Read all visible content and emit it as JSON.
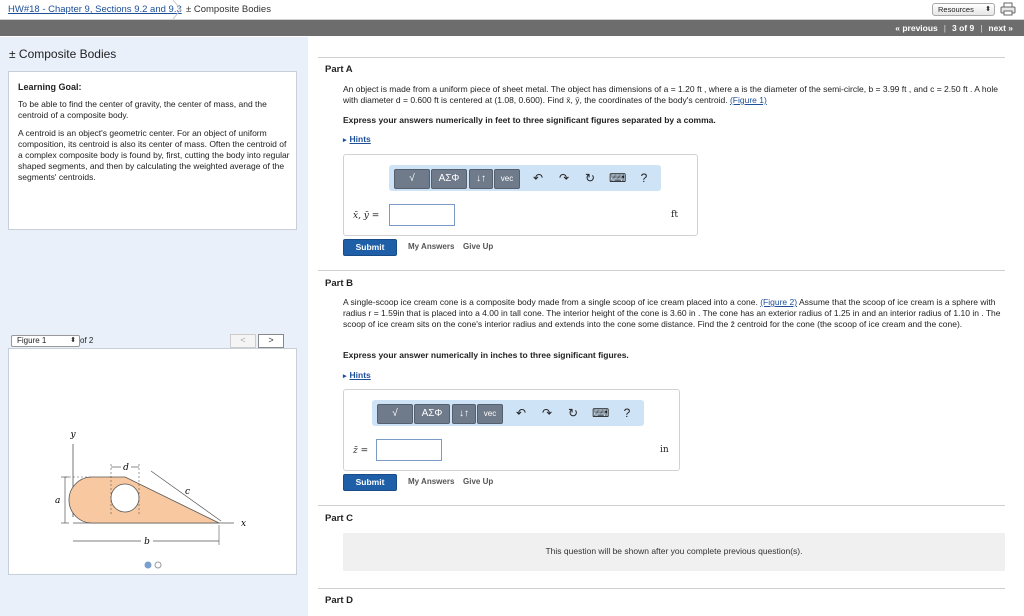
{
  "header": {
    "breadcrumb_link": "HW#18 - Chapter 9, Sections 9.2 and 9.3",
    "breadcrumb_current": "± Composite Bodies",
    "resources_label": "Resources"
  },
  "nav": {
    "previous": "« previous",
    "position": "3 of 9",
    "next": "next »"
  },
  "left": {
    "title": "± Composite Bodies",
    "goal_heading": "Learning Goal:",
    "goal_p1": "To be able to find the center of gravity, the center of mass, and the centroid of a composite body.",
    "goal_p2": "A centroid is an object's geometric center. For an object of uniform composition, its centroid is also its center of mass. Often the centroid of a complex composite body is found by, first, cutting the body into regular shaped segments, and then by calculating the weighted average of the segments' centroids.",
    "figure_select": "Figure 1",
    "figure_of": "of 2",
    "figure_prev": "<",
    "figure_next": ">",
    "figure_labels": {
      "y": "y",
      "d": "d",
      "a": "a",
      "c": "c",
      "b": "b",
      "x": "x"
    }
  },
  "colors": {
    "accent": "#1f5fa8",
    "navbar": "#6d6d6d",
    "left_panel": "#e9f0fa",
    "shape_fill": "#f8c9a0",
    "toolbar_bg": "#cfe3f7"
  },
  "toolbar": {
    "templates": "√",
    "greek": "ΑΣΦ",
    "updown": "↓↑",
    "vec": "vec",
    "undo": "↶",
    "redo": "↷",
    "reset": "↻",
    "keyboard": "⌨",
    "help": "?"
  },
  "partA": {
    "heading": "Part A",
    "text": "An object is made from a uniform piece of sheet metal. The object has dimensions of a = 1.20 ft , where a is the diameter of the semi-circle, b = 3.99 ft , and c = 2.50 ft . A hole with diameter d = 0.600 ft is centered at (1.08, 0.600). Find x̄, ȳ, the coordinates of the body's centroid.",
    "figure_link": "(Figure 1)",
    "instruction": "Express your answers numerically in feet to three significant figures separated by a comma.",
    "hints": "Hints",
    "var_label": "x̄, ȳ =",
    "unit": "ft",
    "submit": "Submit",
    "my_answers": "My Answers",
    "give_up": "Give Up"
  },
  "partB": {
    "heading": "Part B",
    "text_before_link": "A single-scoop ice cream cone is a composite body made from a single scoop of ice cream placed into a cone.",
    "figure_link": "(Figure 2)",
    "text_after_link": "Assume that the scoop of ice cream is a sphere with radius r = 1.59in that is placed into a 4.00 in tall cone. The interior height of the cone is 3.60 in . The cone has an exterior radius of 1.25 in and an interior radius of 1.10 in . The scoop of ice cream sits on the cone's interior radius and extends into the cone some distance. Find the z̄ centroid for the cone (the scoop of ice cream and the cone).",
    "instruction": "Express your answer numerically in inches to three significant figures.",
    "hints": "Hints",
    "var_label": "z̄ =",
    "unit": "in",
    "submit": "Submit",
    "my_answers": "My Answers",
    "give_up": "Give Up"
  },
  "partC": {
    "heading": "Part C",
    "locked_message": "This question will be shown after you complete previous question(s)."
  },
  "partD": {
    "heading": "Part D"
  }
}
